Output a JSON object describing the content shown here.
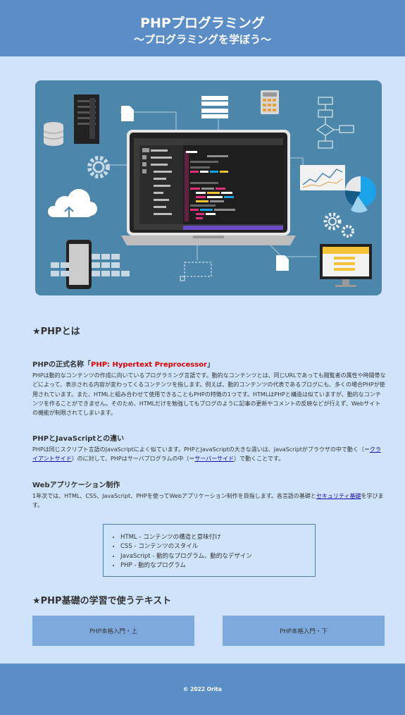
{
  "header": {
    "title": "PHPプログラミング",
    "subtitle": "～プログラミングを学ぼう～"
  },
  "about": {
    "heading": "★PHPとは",
    "sections": [
      {
        "title_prefix": "PHPの正式名称「",
        "title_highlight": "PHP: Hypertext Preprocessor",
        "title_suffix": "」",
        "body": "PHPは動的なコンテンツの作成に向いているプログラミング言語です。動的なコンテンツとは、同じURLであっても閲覧者の属性や時間帯などによって、表示される内容が変わってくるコンテンツを指します。例えば、動的コンテンツの代表であるブログにも、多くの場合PHPが使用されています。また、HTMLと組み合わせて使用できることもPHPの特徴の1つです。HTMLはPHPと構造は似ていますが、動的なコンテンツを作ることができません。そのため、HTMLだけを勉強してもブログのように記事の更新やコメントの反映などが行えず、Webサイトの機能が制限されてしまいます。"
      },
      {
        "title": "PHPとJavaScriptとの違い",
        "body_1": "PHPは同じスクリプト言語のJavaScriptによく似ています。PHPとJavaScriptの大きな違いは、JavaScriptがブラウザの中で動く（＝",
        "link_1": "クライアントサイド",
        "body_2": "）のに対して、PHPはサーバプログラムの中（＝",
        "link_2": "サーバーサイド",
        "body_3": "）で動くことです。"
      },
      {
        "title": "Webアプリケーション制作",
        "body_1": "1年次では、HTML、CSS、JavaScript、PHPを使ってWebアプリケーション制作を目指します。各言語の基礎と",
        "link": "セキュリティ基礎",
        "body_2": "を学びます。"
      }
    ],
    "list": [
      "HTML - コンテンツの構造と意味付け",
      "CSS - コンテンツのスタイル",
      "JavaScript - 動的なプログラム、動的なデザイン",
      "PHP - 動的なプログラム"
    ]
  },
  "texts": {
    "heading": "★PHP基礎の学習で使うテキスト",
    "books": [
      "PHP本格入門・上",
      "PHP本格入門・下"
    ]
  },
  "footer": {
    "copyright": "© 2022 Orita"
  },
  "colors": {
    "header_bg": "#5b8dc7",
    "page_bg": "#cfe4fb",
    "hero_bg": "#4c87ab",
    "button_bg": "#7ea9dc",
    "highlight": "#e00000"
  }
}
